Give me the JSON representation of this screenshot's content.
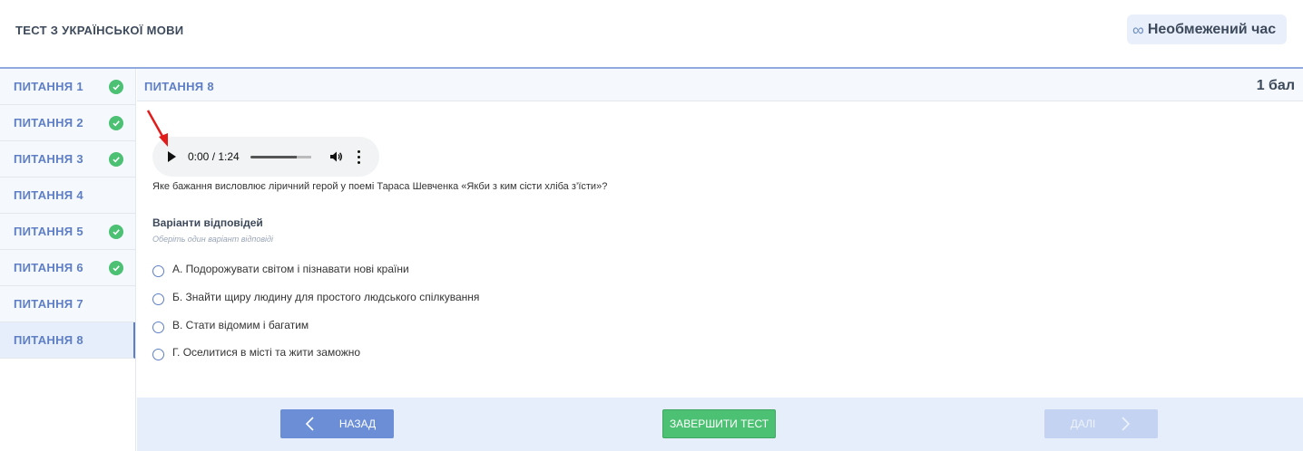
{
  "header": {
    "test_title": "ТЕСТ З УКРАЇНСЬКОЇ МОВИ",
    "timer_icon": "infinity-icon",
    "timer_label": "Необмежений час"
  },
  "sidebar": {
    "items": [
      {
        "label": "ПИТАННЯ 1",
        "answered": true
      },
      {
        "label": "ПИТАННЯ 2",
        "answered": true
      },
      {
        "label": "ПИТАННЯ 3",
        "answered": true
      },
      {
        "label": "ПИТАННЯ 4",
        "answered": false
      },
      {
        "label": "ПИТАННЯ 5",
        "answered": true
      },
      {
        "label": "ПИТАННЯ 6",
        "answered": true
      },
      {
        "label": "ПИТАННЯ 7",
        "answered": false
      },
      {
        "label": "ПИТАННЯ 8",
        "answered": false,
        "active": true
      }
    ]
  },
  "question": {
    "number_label": "ПИТАННЯ 8",
    "points": "1 бал",
    "audio": {
      "time": "0:00 / 1:24",
      "progress": 0.0
    },
    "text": "Яке бажання висловлює ліричний герой у поемі Тараса Шевченка «Якби з ким сісти хліба з’їсти»?",
    "variants_title": "Варіанти відповідей",
    "variants_hint": "Оберіть один варіант відповіді",
    "options": [
      "А. Подорожувати світом і пізнавати нові країни",
      "Б. Знайти щиру людину для простого людського спілкування",
      "В. Стати відомим і багатим",
      "Г. Оселитися в місті та жити заможно"
    ]
  },
  "footer": {
    "back_label": "НАЗАД",
    "finish_label": "ЗАВЕРШИТИ ТЕСТ",
    "next_label": "ДАЛІ"
  },
  "colors": {
    "accent": "#5e7fc6",
    "success": "#4cc073",
    "annotation_arrow": "#e21b1b"
  }
}
